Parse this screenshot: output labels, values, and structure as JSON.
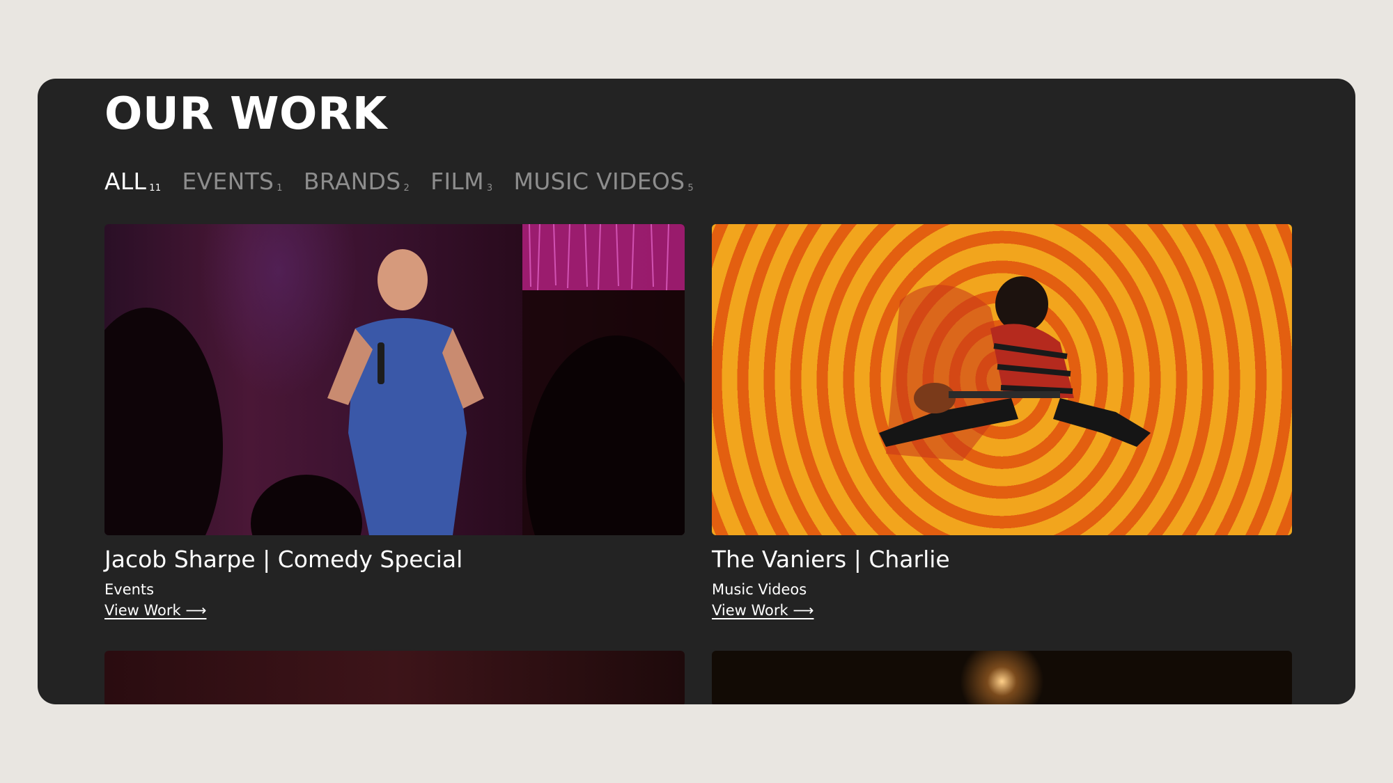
{
  "section": {
    "title": "OUR WORK"
  },
  "filters": [
    {
      "label": "ALL",
      "count": "11",
      "active": true
    },
    {
      "label": "EVENTS",
      "count": "1",
      "active": false
    },
    {
      "label": "BRANDS",
      "count": "2",
      "active": false
    },
    {
      "label": "FILM",
      "count": "3",
      "active": false
    },
    {
      "label": "MUSIC VIDEOS",
      "count": "5",
      "active": false
    }
  ],
  "cards": [
    {
      "title": "Jacob Sharpe | Comedy Special",
      "category": "Events",
      "link": "View Work ⟶"
    },
    {
      "title": "The Vaniers | Charlie",
      "category": "Music Videos",
      "link": "View Work ⟶"
    }
  ],
  "colors": {
    "page_bg": "#e9e6e1",
    "panel_bg": "#232323",
    "text": "#ffffff",
    "muted": "#8d8d8d"
  }
}
